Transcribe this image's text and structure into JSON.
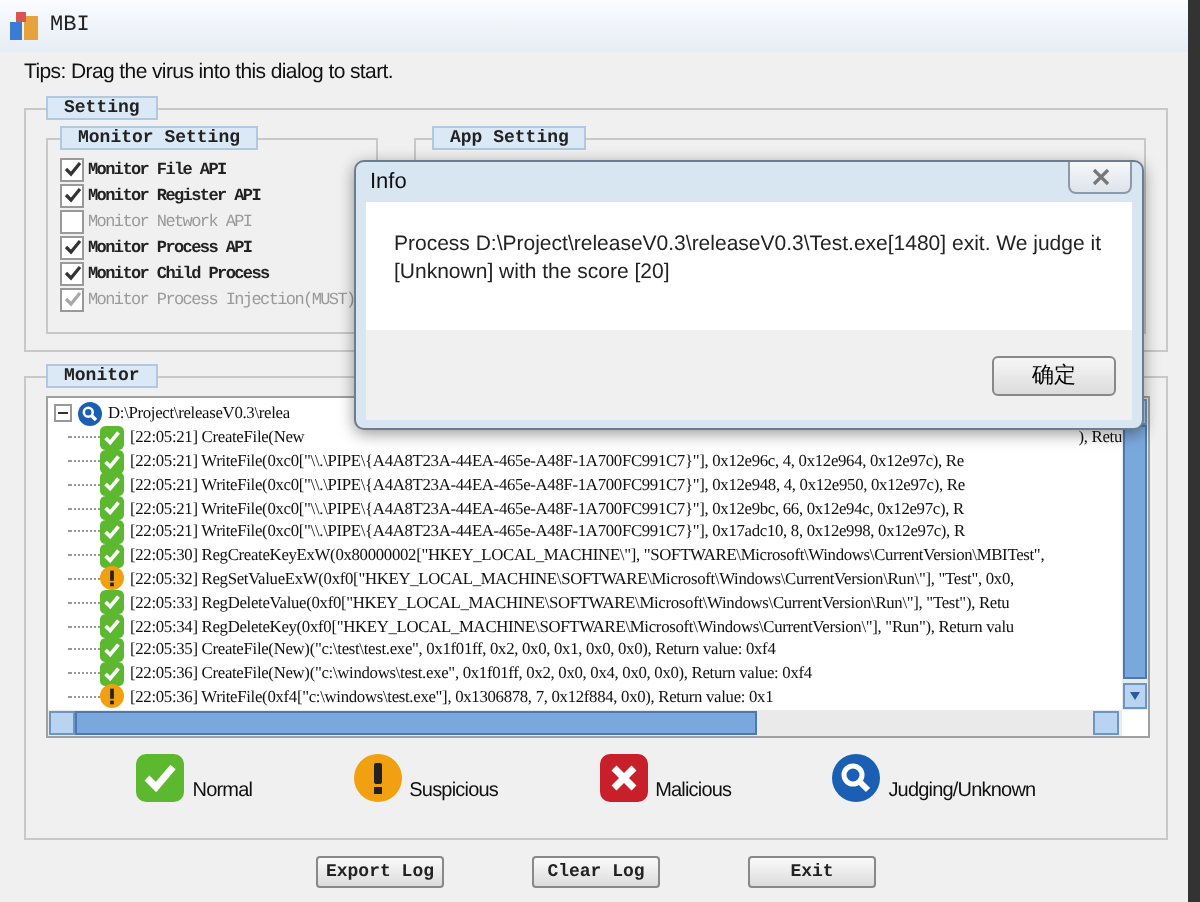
{
  "window": {
    "title": "MBI"
  },
  "tips": "Tips: Drag the virus into this dialog to start.",
  "setting": {
    "label": "Setting",
    "monitor_setting": {
      "label": "Monitor Setting",
      "options": [
        {
          "label": "Monitor File API",
          "checked": true,
          "disabled": false
        },
        {
          "label": "Monitor Register API",
          "checked": true,
          "disabled": false
        },
        {
          "label": "Monitor Network API",
          "checked": false,
          "disabled": true
        },
        {
          "label": "Monitor Process API",
          "checked": true,
          "disabled": false
        },
        {
          "label": "Monitor Child Process",
          "checked": true,
          "disabled": false
        },
        {
          "label": "Monitor Process Injection(MUST)",
          "checked": true,
          "disabled": true
        }
      ]
    },
    "app_setting": {
      "label": "App Setting"
    }
  },
  "monitor": {
    "label": "Monitor",
    "log": {
      "root": {
        "text": "D:\\Project\\releaseV0.3\\relea",
        "expanded": true,
        "kind": "judging"
      },
      "rows": [
        {
          "kind": "normal",
          "text": "[22:05:21] CreateFile(New",
          "tail": "), Retu"
        },
        {
          "kind": "normal",
          "text": "[22:05:21] WriteFile(0xc0[\"\\\\.\\PIPE\\{A4A8T23A-44EA-465e-A48F-1A700FC991C7}\"], 0x12e96c, 4, 0x12e964, 0x12e97c), Re"
        },
        {
          "kind": "normal",
          "text": "[22:05:21] WriteFile(0xc0[\"\\\\.\\PIPE\\{A4A8T23A-44EA-465e-A48F-1A700FC991C7}\"], 0x12e948, 4, 0x12e950, 0x12e97c), Re"
        },
        {
          "kind": "normal",
          "text": "[22:05:21] WriteFile(0xc0[\"\\\\.\\PIPE\\{A4A8T23A-44EA-465e-A48F-1A700FC991C7}\"], 0x12e9bc, 66, 0x12e94c, 0x12e97c), R"
        },
        {
          "kind": "normal",
          "text": "[22:05:21] WriteFile(0xc0[\"\\\\.\\PIPE\\{A4A8T23A-44EA-465e-A48F-1A700FC991C7}\"], 0x17adc10, 8, 0x12e998, 0x12e97c), R"
        },
        {
          "kind": "normal",
          "text": "[22:05:30] RegCreateKeyExW(0x80000002[\"HKEY_LOCAL_MACHINE\\\"], \"SOFTWARE\\Microsoft\\Windows\\CurrentVersion\\MBITest\","
        },
        {
          "kind": "suspicious",
          "text": "[22:05:32] RegSetValueExW(0xf0[\"HKEY_LOCAL_MACHINE\\SOFTWARE\\Microsoft\\Windows\\CurrentVersion\\Run\\\"], \"Test\", 0x0,"
        },
        {
          "kind": "normal",
          "text": "[22:05:33] RegDeleteValue(0xf0[\"HKEY_LOCAL_MACHINE\\SOFTWARE\\Microsoft\\Windows\\CurrentVersion\\Run\\\"], \"Test\"), Retu"
        },
        {
          "kind": "normal",
          "text": "[22:05:34] RegDeleteKey(0xf0[\"HKEY_LOCAL_MACHINE\\SOFTWARE\\Microsoft\\Windows\\CurrentVersion\\\"], \"Run\"), Return valu"
        },
        {
          "kind": "normal",
          "text": "[22:05:35] CreateFile(New)(\"c:\\test\\test.exe\", 0x1f01ff, 0x2, 0x0, 0x1, 0x0, 0x0), Return value: 0xf4"
        },
        {
          "kind": "normal",
          "text": "[22:05:36] CreateFile(New)(\"c:\\windows\\test.exe\", 0x1f01ff, 0x2, 0x0, 0x4, 0x0, 0x0), Return value: 0xf4"
        },
        {
          "kind": "suspicious",
          "text": "[22:05:36] WriteFile(0xf4[\"c:\\windows\\test.exe\"], 0x1306878, 7, 0x12f884, 0x0), Return value: 0x1"
        }
      ]
    },
    "legend": [
      {
        "kind": "normal",
        "label": "Normal"
      },
      {
        "kind": "suspicious",
        "label": "Suspicious"
      },
      {
        "kind": "malicious",
        "label": "Malicious"
      },
      {
        "kind": "judging",
        "label": "Judging/Unknown"
      }
    ]
  },
  "buttons": [
    "Export Log",
    "Clear Log",
    "Exit"
  ],
  "dialog": {
    "title": "Info",
    "message": "Process D:\\Project\\releaseV0.3\\releaseV0.3\\Test.exe[1480] exit. We judge it [Unknown] with the score [20]",
    "button": "确定"
  }
}
